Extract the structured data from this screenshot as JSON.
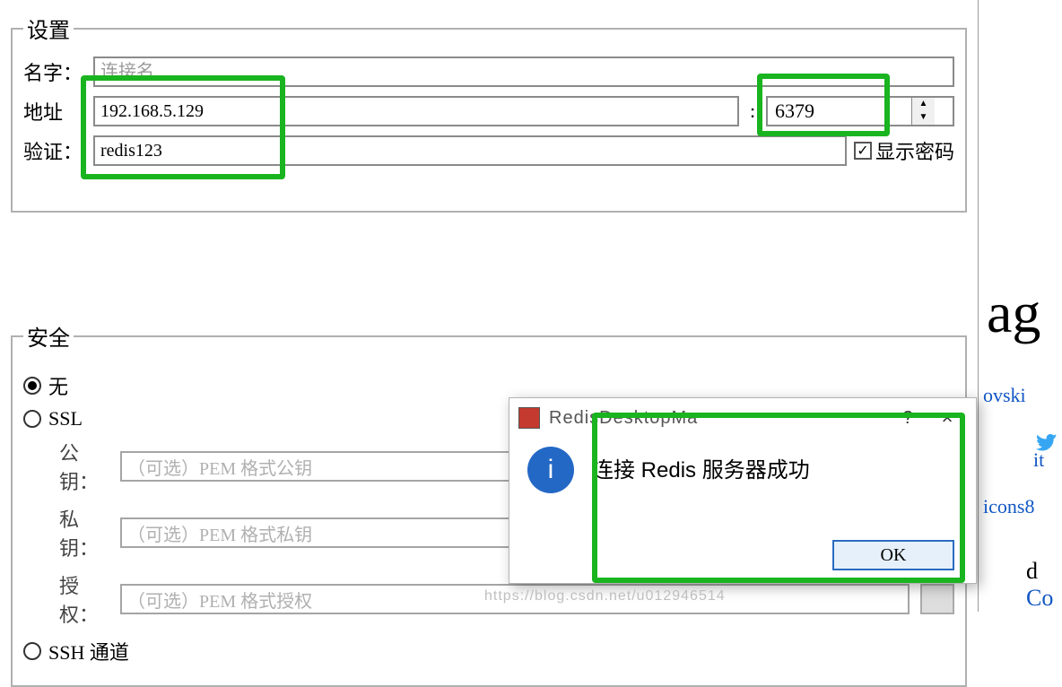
{
  "settings_group": {
    "legend": "设置",
    "name_label": "名字：",
    "name_placeholder": "连接名",
    "addr_label": "地址",
    "addr_value": "192.168.5.129",
    "port_sep": ":",
    "port_value": "6379",
    "auth_label": "验证：",
    "auth_value": "redis123",
    "show_pw_label": "显示密码",
    "show_pw_checked": true
  },
  "security_group": {
    "legend": "安全",
    "option_none": "无",
    "option_ssl": "SSL",
    "option_ssh": "SSH 通道",
    "selected": "none",
    "pubkey_label": "公钥：",
    "pubkey_placeholder": "（可选）PEM 格式公钥",
    "privkey_label": "私钥：",
    "privkey_placeholder": "（可选）PEM 格式私钥",
    "authfile_label": "授权：",
    "authfile_placeholder": "（可选）PEM 格式授权"
  },
  "dialog": {
    "title": "RedisDesktopMa",
    "message": "连接 Redis 服务器成功",
    "ok_label": "OK",
    "help_label": "?",
    "close_label": "×"
  },
  "side": {
    "big_fragment": "ag",
    "link_ovski": "ovski",
    "link_it": "it",
    "link_icons8": "icons8",
    "tail_d": "d",
    "tail_co_link": "Co"
  },
  "watermark": "https://blog.csdn.net/u012946514"
}
